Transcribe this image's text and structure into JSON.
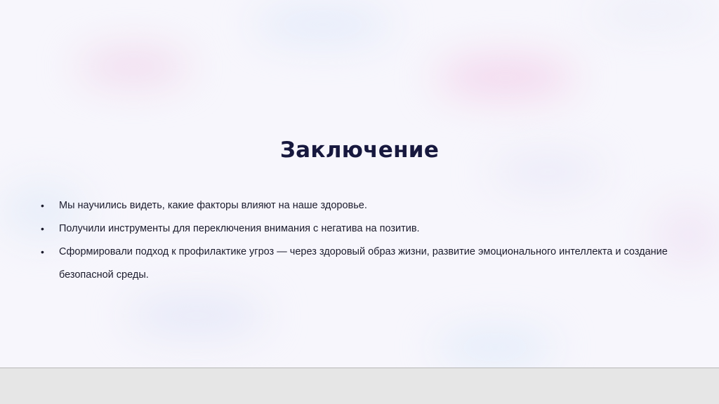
{
  "slide": {
    "title": "Заключение",
    "bullets": [
      "Мы научились видеть, какие факторы влияют на наше здоровье.",
      "Получили инструменты для переключения внимания с негатива на позитив.",
      "Сформировали подход к профилактике угроз — через здоровый образ жизни, развитие эмоционального интеллекта и создание безопасной среды."
    ],
    "bullet_glyph": "•"
  },
  "colors": {
    "background": "#f7f6fc",
    "title": "#17183e",
    "text": "#1b1b2c",
    "footer_bar": "#e6e6e6"
  }
}
